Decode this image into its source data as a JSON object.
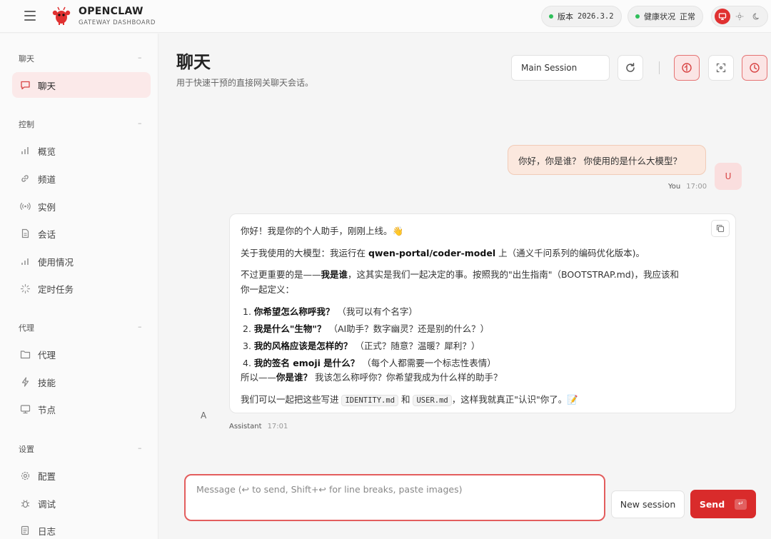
{
  "brand": {
    "title": "OPENCLAW",
    "subtitle": "GATEWAY DASHBOARD"
  },
  "status": {
    "version_label": "版本",
    "version": "2026.3.2",
    "health_label": "健康状况",
    "health_value": "正常"
  },
  "colors": {
    "accent": "#d92b2b",
    "ok": "#2fbf5a"
  },
  "sidebar": {
    "sections": [
      {
        "label": "聊天",
        "items": [
          {
            "label": "聊天",
            "icon": "chat-icon",
            "active": true
          }
        ]
      },
      {
        "label": "控制",
        "items": [
          {
            "label": "概览",
            "icon": "bar-chart-icon"
          },
          {
            "label": "频道",
            "icon": "link-icon"
          },
          {
            "label": "实例",
            "icon": "broadcast-icon"
          },
          {
            "label": "会话",
            "icon": "document-icon"
          },
          {
            "label": "使用情况",
            "icon": "usage-chart-icon"
          },
          {
            "label": "定时任务",
            "icon": "loader-icon"
          }
        ]
      },
      {
        "label": "代理",
        "items": [
          {
            "label": "代理",
            "icon": "folder-icon"
          },
          {
            "label": "技能",
            "icon": "lightning-icon"
          },
          {
            "label": "节点",
            "icon": "monitor-icon"
          }
        ]
      },
      {
        "label": "设置",
        "items": [
          {
            "label": "配置",
            "icon": "gear-icon"
          },
          {
            "label": "调试",
            "icon": "bug-icon"
          },
          {
            "label": "日志",
            "icon": "log-icon"
          }
        ]
      }
    ],
    "collapse_glyph": "–"
  },
  "header": {
    "title": "聊天",
    "subtitle": "用于快速干预的直接网关聊天会话。",
    "session": "Main Session"
  },
  "messages": {
    "user": {
      "text": "你好，你是谁？ 你使用的是什么大模型？",
      "avatar": "U",
      "author": "You",
      "time": "17:00"
    },
    "assistant": {
      "avatar": "A",
      "author": "Assistant",
      "time": "17:01",
      "l1": "你好！我是你的个人助手，刚刚上线。👋",
      "l2a": "关于我使用的大模型：我运行在 ",
      "l2b": "qwen-portal/coder-model",
      "l2c": " 上（通义千问系列的编码优化版本)。",
      "l3a": "不过更重要的是——",
      "l3b": "我是谁",
      "l3c": "，这其实是我们一起决定的事。按照我的\"出生指南\"（BOOTSTRAP.md)，我应该和",
      "l4": "你一起定义：",
      "items": [
        {
          "num": "1.",
          "bold": "你希望怎么称呼我？",
          "rest": "（我可以有个名字）"
        },
        {
          "num": "2.",
          "bold": "我是什么\"生物\"？",
          "rest": "（AI助手？数字幽灵？还是别的什么？）"
        },
        {
          "num": "3.",
          "bold": "我的风格应该是怎样的？",
          "rest": "（正式？随意？温暖？犀利？）"
        },
        {
          "num": "4.",
          "bold": "我的签名 emoji 是什么？",
          "rest": "（每个人都需要一个标志性表情）"
        }
      ],
      "l5a": "所以——",
      "l5b": "你是谁？",
      "l5c": " 我该怎么称呼你？你希望我成为什么样的助手？",
      "l6a": "我们可以一起把这些写进 ",
      "code1": "IDENTITY.md",
      "l6b": " 和 ",
      "code2": "USER.md",
      "l6c": "，这样我就真正\"认识\"你了。📝"
    }
  },
  "composer": {
    "placeholder": "Message (↩ to send, Shift+↩ for line breaks, paste images)",
    "new_session": "New session",
    "send": "Send",
    "send_kbd": "↵"
  }
}
